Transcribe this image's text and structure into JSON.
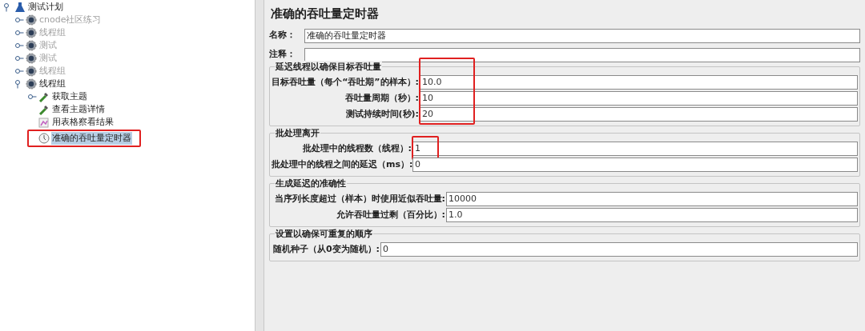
{
  "tree": {
    "label": "测试计划",
    "expanded": true,
    "children": [
      {
        "label": "cnode社区练习",
        "disabled": true,
        "expanded": false,
        "kind": "group"
      },
      {
        "label": "线程组",
        "disabled": true,
        "expanded": false,
        "kind": "group"
      },
      {
        "label": "测试",
        "disabled": true,
        "expanded": false,
        "kind": "group"
      },
      {
        "label": "测试",
        "disabled": true,
        "expanded": false,
        "kind": "group"
      },
      {
        "label": "线程组",
        "disabled": true,
        "expanded": false,
        "kind": "group"
      },
      {
        "label": "线程组",
        "disabled": false,
        "expanded": true,
        "kind": "group",
        "children": [
          {
            "label": "获取主题",
            "kind": "sampler",
            "expanded": false,
            "selected": false
          },
          {
            "label": "查看主题详情",
            "kind": "sampler",
            "selected": false
          },
          {
            "label": "用表格察看结果",
            "kind": "listener",
            "selected": false
          },
          {
            "label": "准确的吞吐量定时器",
            "kind": "timer",
            "selected": true,
            "annotated": true
          }
        ]
      }
    ]
  },
  "panel": {
    "title": "准确的吞吐量定时器",
    "name": {
      "label": "名称：",
      "value": "准确的吞吐量定时器"
    },
    "comment": {
      "label": "注释："
    },
    "groups": [
      {
        "title": "延迟线程以确保目标吞吐量",
        "annotated": true,
        "fields": [
          {
            "label": "目标吞吐量（每个“吞吐期”的样本）:",
            "value": "10.0"
          },
          {
            "label": "吞吐量周期（秒）:",
            "value": "10"
          },
          {
            "label": "测试持续时间(秒):",
            "value": "20"
          }
        ]
      },
      {
        "title": "批处理离开",
        "fields": [
          {
            "label": "批处理中的线程数（线程）:",
            "value": "1",
            "annotated": true
          },
          {
            "label": "批处理中的线程之间的延迟（ms）:",
            "value": "0"
          }
        ]
      },
      {
        "title": "生成延迟的准确性",
        "fields": [
          {
            "label": "当序列长度超过（样本）时使用近似吞吐量:",
            "value": "10000"
          },
          {
            "label": "允许吞吐量过剩（百分比）:",
            "value": "1.0"
          }
        ]
      },
      {
        "title": "设置以确保可重复的顺序",
        "fields": [
          {
            "label": "随机种子（从0变为随机）:",
            "value": "0"
          }
        ]
      }
    ]
  }
}
